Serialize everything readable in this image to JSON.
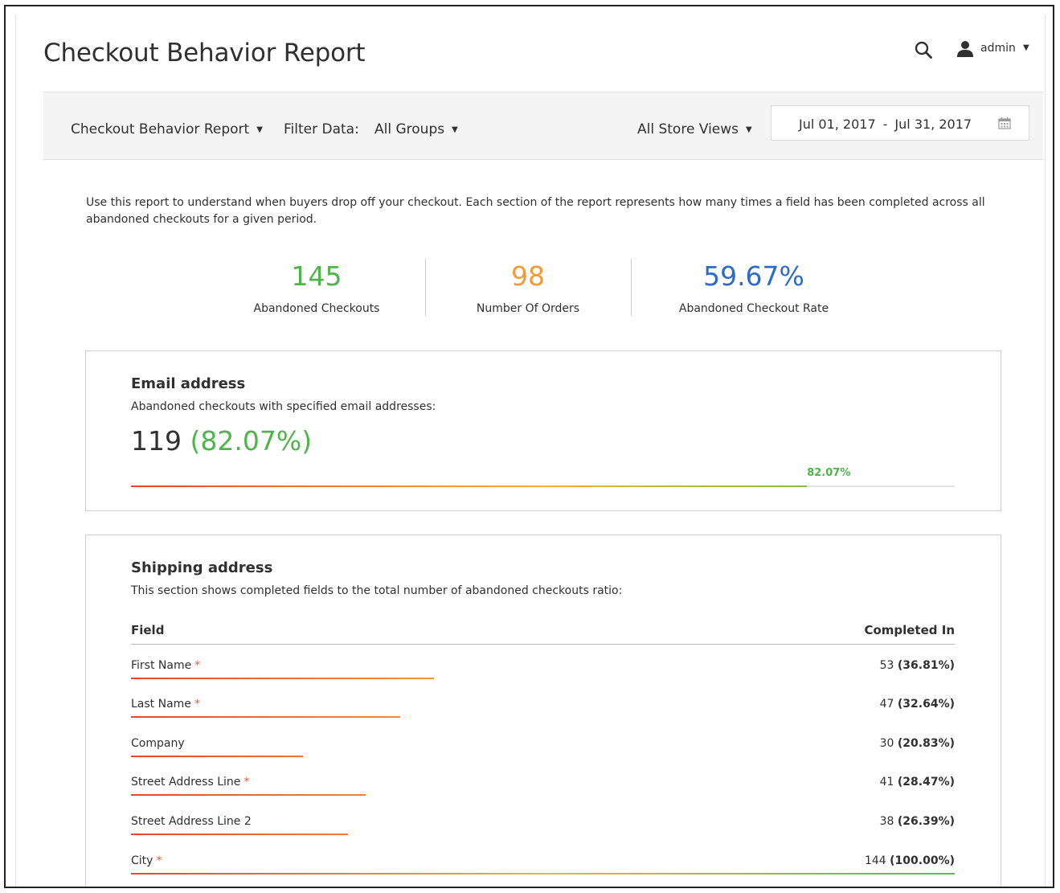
{
  "header": {
    "title": "Checkout Behavior Report",
    "user": "admin"
  },
  "toolbar": {
    "report_select": "Checkout Behavior Report",
    "filter_label": "Filter Data:",
    "group_select": "All Groups",
    "store_select": "All Store Views",
    "date_from": "Jul 01, 2017",
    "date_separator": "-",
    "date_to": "Jul 31, 2017"
  },
  "intro": "Use this report to understand when buyers drop off your checkout. Each section of the report represents how many times a field has been completed across all abandoned checkouts for a given period.",
  "stats": [
    {
      "value": "145",
      "label": "Abandoned Checkouts",
      "color": "#4cb648"
    },
    {
      "value": "98",
      "label": "Number Of Orders",
      "color": "#f49a37"
    },
    {
      "value": "59.67%",
      "label": "Abandoned Checkout Rate",
      "color": "#2c6bc7"
    }
  ],
  "email_section": {
    "title": "Email address",
    "subtitle": "Abandoned checkouts with specified email addresses:",
    "count": "119",
    "percent": "(82.07%)",
    "bar_label": "82.07%",
    "bar_fraction": 0.8207
  },
  "shipping_section": {
    "title": "Shipping address",
    "subtitle": "This section shows completed fields to the total number of abandoned checkouts ratio:",
    "col_field": "Field",
    "col_completed": "Completed In",
    "rows": [
      {
        "name": "First Name",
        "required": true,
        "count": "53",
        "percent": "(36.81%)",
        "fraction": 0.3681
      },
      {
        "name": "Last Name",
        "required": true,
        "count": "47",
        "percent": "(32.64%)",
        "fraction": 0.3264
      },
      {
        "name": "Company",
        "required": false,
        "count": "30",
        "percent": "(20.83%)",
        "fraction": 0.2083
      },
      {
        "name": "Street Address Line",
        "required": true,
        "count": "41",
        "percent": "(28.47%)",
        "fraction": 0.2847
      },
      {
        "name": "Street Address Line 2",
        "required": false,
        "count": "38",
        "percent": "(26.39%)",
        "fraction": 0.2639
      },
      {
        "name": "City",
        "required": true,
        "count": "144",
        "percent": "(100.00%)",
        "fraction": 1.0
      }
    ]
  },
  "colors": {
    "green": "#4cb648",
    "orange": "#f49a37",
    "blue": "#2c6bc7",
    "required": "#e75b3a",
    "gradient_start": "#e8472e",
    "gradient_mid": "#f2b33a",
    "gradient_end": "#4cc63d"
  },
  "icons": {
    "search": "search-icon",
    "user": "user-icon",
    "calendar": "calendar-icon"
  }
}
